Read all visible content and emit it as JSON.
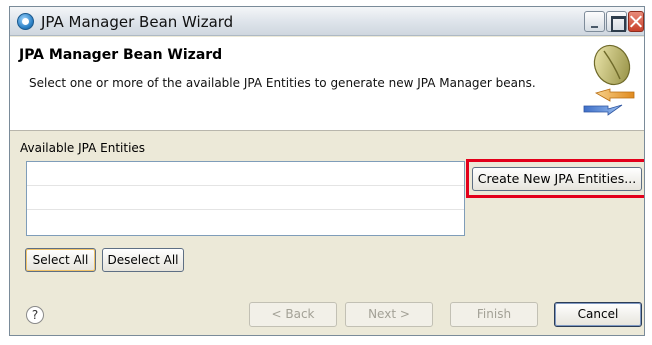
{
  "window": {
    "title": "JPA Manager Bean Wizard",
    "icon": "wizard-app-icon"
  },
  "header": {
    "title": "JPA Manager Bean Wizard",
    "description": "Select one or more of the available JPA Entities to generate new JPA Manager beans.",
    "logo_icon": "bean-with-arrows-icon"
  },
  "entities": {
    "label": "Available JPA Entities",
    "items": []
  },
  "buttons": {
    "create_new": "Create New JPA Entities...",
    "select_all": "Select All",
    "deselect_all": "Deselect All",
    "back": "< Back",
    "next": "Next >",
    "finish": "Finish",
    "cancel": "Cancel"
  },
  "colors": {
    "highlight": "#e3001b",
    "window_bg": "#ece9d8"
  }
}
